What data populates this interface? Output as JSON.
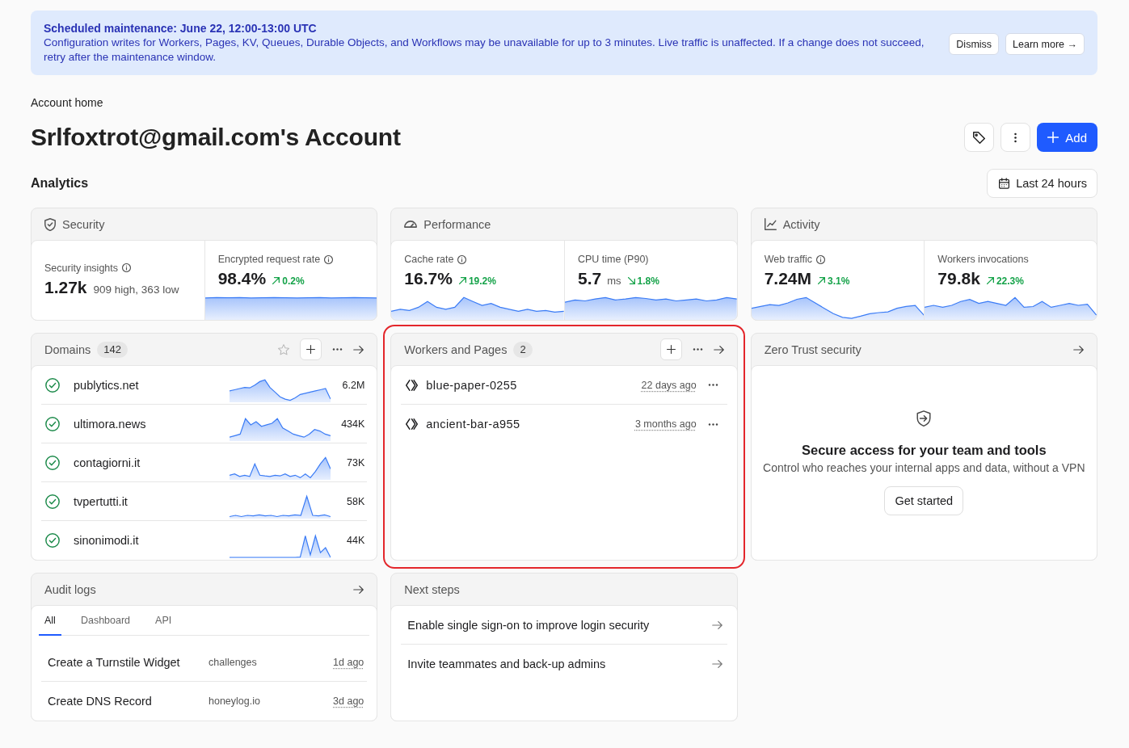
{
  "banner": {
    "title": "Scheduled maintenance: June 22, 12:00-13:00 UTC",
    "message": "Configuration writes for Workers, Pages, KV, Queues, Durable Objects, and Workflows may be unavailable for up to 3 minutes. Live traffic is unaffected. If a change does not succeed, retry after the maintenance window.",
    "buttons": [
      {
        "label": "Dismiss"
      },
      {
        "label": "Learn more →"
      }
    ]
  },
  "header": {
    "breadcrumb": "Account home",
    "title": "Srlfoxtrot@gmail.com's Account",
    "add_button": "Add"
  },
  "analytics": {
    "heading": "Analytics",
    "range_button": "Last 24 hours",
    "cards": [
      {
        "kind": "security",
        "title": "Security",
        "metrics": [
          {
            "kind": "summary",
            "label": "Security insights",
            "info": true,
            "value": "1.27k",
            "detail": "909 high, 363 low"
          },
          {
            "kind": "trend",
            "label": "Encrypted request rate",
            "info": true,
            "value": "98.4%",
            "delta": "0.2%",
            "rising": true
          }
        ]
      },
      {
        "kind": "performance",
        "title": "Performance",
        "metrics": [
          {
            "kind": "trend",
            "label": "Cache rate",
            "info": true,
            "value": "16.7%",
            "delta": "19.2%",
            "rising": true
          },
          {
            "kind": "trend",
            "label": "CPU time (P90)",
            "info": false,
            "value": "5.7",
            "unit": "ms",
            "delta": "1.8%",
            "rising": false
          }
        ]
      },
      {
        "kind": "activity",
        "title": "Activity",
        "metrics": [
          {
            "kind": "trend",
            "label": "Web traffic",
            "info": true,
            "value": "7.24M",
            "delta": "3.1%",
            "rising": true
          },
          {
            "kind": "trend",
            "label": "Workers invocations",
            "info": false,
            "value": "79.8k",
            "delta": "22.3%",
            "rising": true
          }
        ]
      }
    ]
  },
  "domains": {
    "title": "Domains",
    "count": "142",
    "starred": false,
    "rows": [
      {
        "name": "publytics.net",
        "value": "6.2M",
        "active": true
      },
      {
        "name": "ultimora.news",
        "value": "434K",
        "active": true
      },
      {
        "name": "contagiorni.it",
        "value": "73K",
        "active": true
      },
      {
        "name": "tvpertutti.it",
        "value": "58K",
        "active": true
      },
      {
        "name": "sinonimodi.it",
        "value": "44K",
        "active": true
      }
    ]
  },
  "workers": {
    "title": "Workers and Pages",
    "count": "2",
    "highlighted": true,
    "rows": [
      {
        "name": "blue-paper-0255",
        "updated": "22 days ago"
      },
      {
        "name": "ancient-bar-a955",
        "updated": "3 months ago"
      }
    ]
  },
  "zero_trust": {
    "title": "Zero Trust security",
    "heading": "Secure access for your team and tools",
    "text": "Control who reaches your internal apps and data, without a VPN",
    "button": "Get started"
  },
  "audit_logs": {
    "title": "Audit logs",
    "tabs": [
      {
        "label": "All",
        "selected": true
      },
      {
        "label": "Dashboard",
        "selected": false
      },
      {
        "label": "API",
        "selected": false
      }
    ],
    "rows": [
      {
        "action": "Create a Turnstile Widget",
        "target": "challenges",
        "time": "1d ago"
      },
      {
        "action": "Create DNS Record",
        "target": "honeylog.io",
        "time": "3d ago"
      }
    ]
  },
  "next_steps": {
    "title": "Next steps",
    "items": [
      {
        "label": "Enable single sign-on to improve login security"
      },
      {
        "label": "Invite teammates and back-up admins"
      }
    ]
  }
}
